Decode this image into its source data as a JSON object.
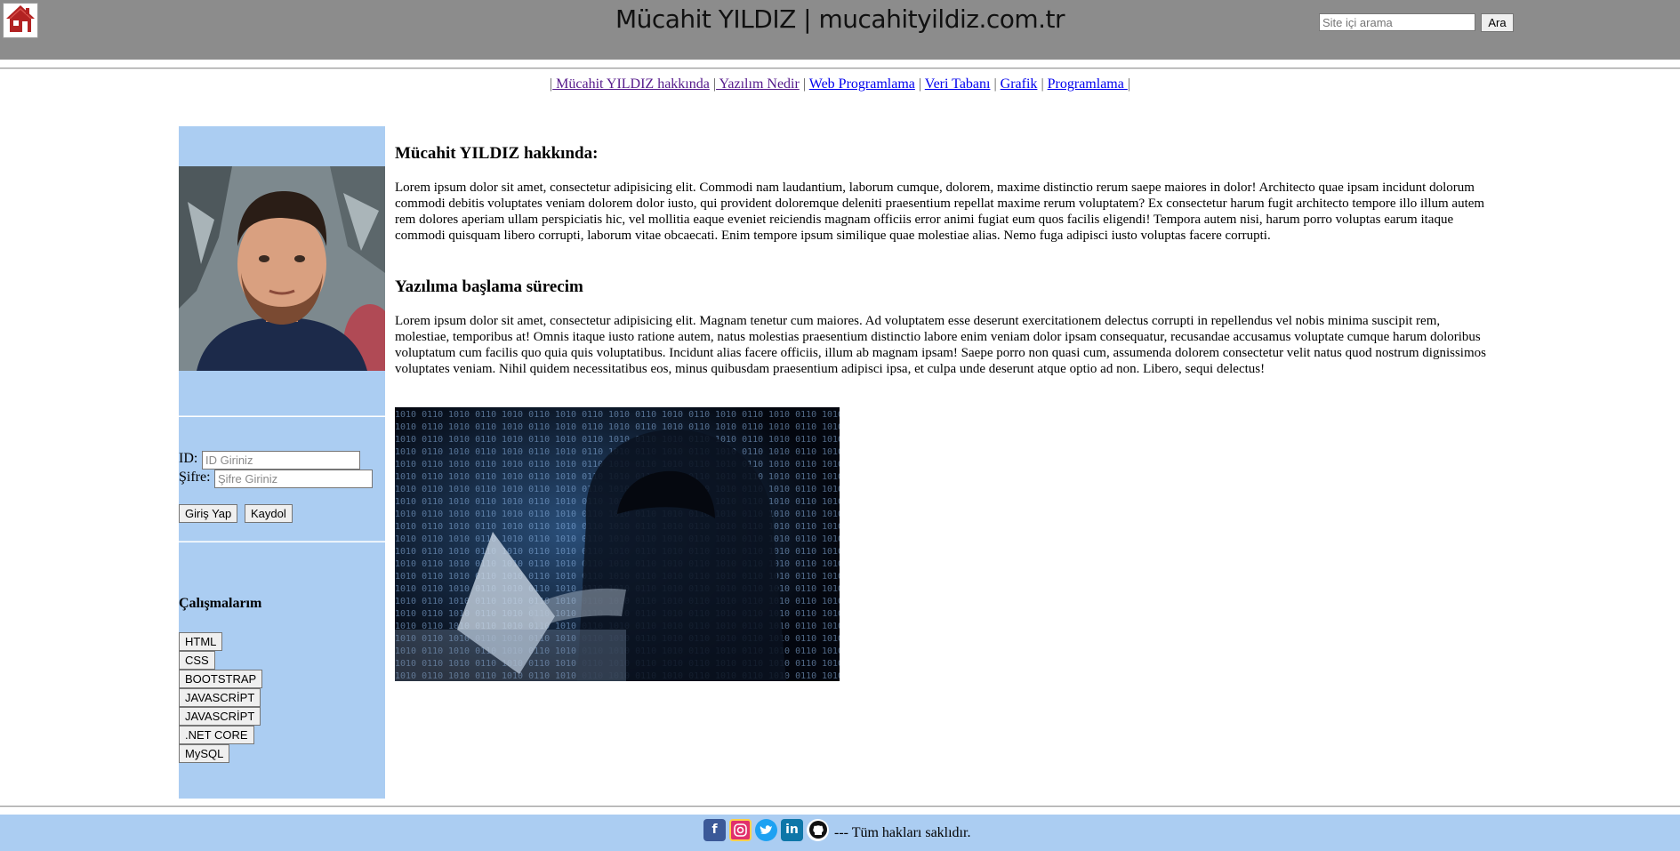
{
  "header": {
    "title": "Mücahit YILDIZ | mucahityildiz.com.tr",
    "home_icon": "house-icon",
    "search": {
      "placeholder": "Site içi arama",
      "value": "",
      "button_label": "Ara"
    }
  },
  "nav": {
    "items": [
      {
        "label": " Mücahit YILDIZ hakkında",
        "visited": true
      },
      {
        "label": " Yazılım Nedir",
        "visited": true
      },
      {
        "label": "Web Programlama",
        "visited": false
      },
      {
        "label": "Veri Tabanı",
        "visited": false
      },
      {
        "label": "Grafik",
        "visited": false
      },
      {
        "label": "Programlama ",
        "visited": false
      }
    ]
  },
  "sidebar": {
    "login": {
      "id_label": "ID:",
      "id_placeholder": "ID Giriniz",
      "password_label": "Şifre:",
      "password_placeholder": "Şifre Giriniz",
      "login_button": "Giriş Yap",
      "register_button": "Kaydol"
    },
    "works": {
      "heading": "Çalışmalarım",
      "items": [
        "HTML",
        "CSS",
        "BOOTSTRAP",
        "JAVASCRİPT",
        "JAVASCRİPT",
        ".NET CORE",
        "MySQL"
      ]
    }
  },
  "main": {
    "section1": {
      "heading": "Mücahit YILDIZ hakkında:",
      "text": "Lorem ipsum dolor sit amet, consectetur adipisicing elit. Commodi nam laudantium, laborum cumque, dolorem, maxime distinctio rerum saepe maiores in dolor! Architecto quae ipsam incidunt dolorum commodi debitis voluptates veniam dolorem dolor iusto, qui provident doloremque deleniti praesentium repellat maxime rerum voluptatem? Ex consectetur harum fugit architecto tempore illo illum autem rem dolores aperiam ullam perspiciatis hic, vel mollitia eaque eveniet reiciendis magnam officiis error animi fugiat eum quos facilis eligendi! Tempora autem nisi, harum porro voluptas earum itaque commodi quisquam libero corrupti, laborum vitae obcaecati. Enim tempore ipsum similique quae molestiae alias. Nemo fuga adipisci iusto voluptas facere corrupti."
    },
    "section2": {
      "heading": "Yazılıma başlama sürecim",
      "text": "Lorem ipsum dolor sit amet, consectetur adipisicing elit. Magnam tenetur cum maiores. Ad voluptatem esse deserunt exercitationem delectus corrupti in repellendus vel nobis minima suscipit rem, molestiae, temporibus at! Omnis itaque iusto ratione autem, natus molestias praesentium distinctio labore enim veniam dolor ipsam consequatur, recusandae accusamus voluptate cumque harum doloribus voluptatum cum facilis quo quia quis voluptatibus. Incidunt alias facere officiis, illum ab magnam ipsam! Saepe porro non quasi cum, assumenda dolorem consectetur velit natus quod nostrum dignissimos voluptates veniam. Nihil quidem necessitatibus eos, minus quibusdam praesentium adipisci ipsa, et culpa unde deserunt atque optio ad non. Libero, sequi delectus!"
    }
  },
  "footer": {
    "social_icons": [
      "facebook-icon",
      "instagram-icon",
      "twitter-icon",
      "linkedin-icon",
      "github-icon"
    ],
    "text": "--- Tüm hakları saklıdır."
  },
  "colors": {
    "header_bg": "#8c8c8c",
    "sidebar_bg": "#abcdf2",
    "footer_bg": "#abcdf2",
    "home_icon": "#b22222",
    "link": "#0000ee",
    "link_visited": "#551a8b"
  }
}
